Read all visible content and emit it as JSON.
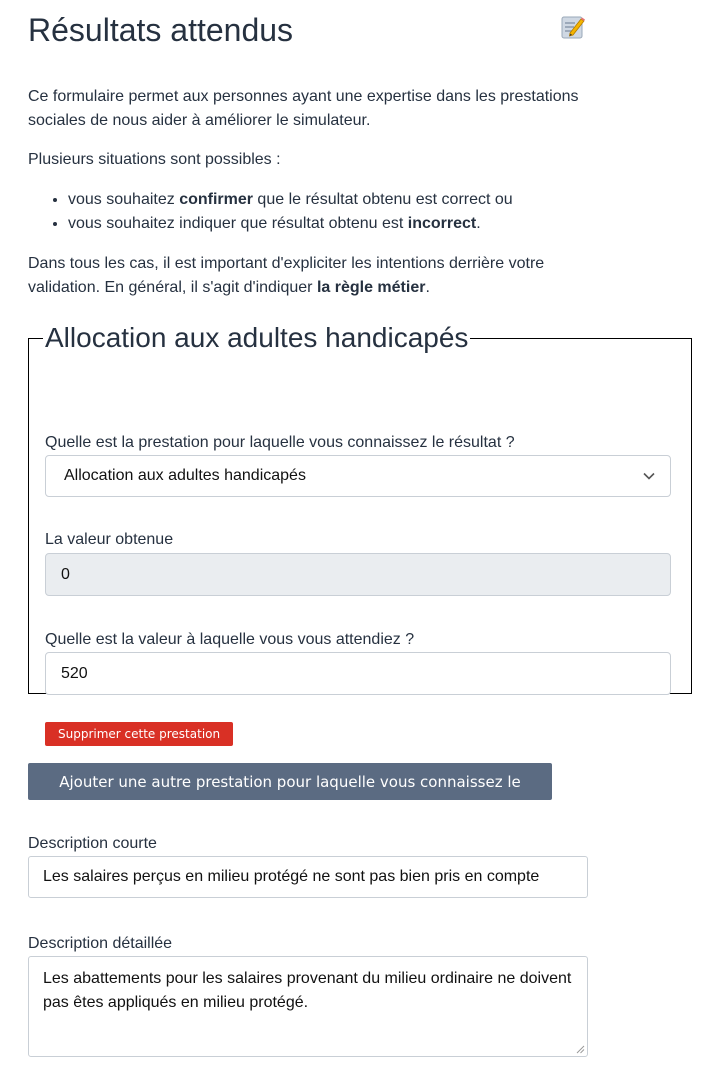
{
  "header": {
    "title": "Résultats attendus",
    "icon": "memo-icon"
  },
  "intro": {
    "paragraph": "Ce formulaire permet aux personnes ayant une expertise dans les prestations sociales de nous aider à améliorer le simulateur.",
    "situations": "Plusieurs situations sont possibles :",
    "case1": {
      "before": "vous souhaitez ",
      "bold": "confirmer",
      "after": " que le résultat obtenu est correct ou"
    },
    "case2": {
      "before": "vous souhaitez indiquer que résultat obtenu est ",
      "bold": "incorrect",
      "after": "."
    },
    "dans": {
      "before": "Dans tous les cas, il est important d'expliciter les intentions derrière votre validation. En général, il s'agit d'indiquer ",
      "bold": "la règle métier",
      "after": "."
    }
  },
  "prestation": {
    "legend": "Allocation aux adultes handicapés",
    "select_label": "Quelle est la prestation pour laquelle vous connaissez le résultat ?",
    "select_value": "Allocation aux adultes handicapés",
    "obtained_label": "La valeur obtenue",
    "obtained_value": "0",
    "expected_label": "Quelle est la valeur à laquelle vous vous attendiez ?",
    "expected_value": "520",
    "delete_label": "Supprimer cette prestation"
  },
  "add_button": "Ajouter une autre prestation pour laquelle vous connaissez le résultat",
  "short_desc": {
    "label": "Description courte",
    "value": "Les salaires perçus en milieu protégé ne sont pas bien pris en compte"
  },
  "long_desc": {
    "label": "Description détaillée",
    "value": "Les abattements pour les salaires provenant du milieu ordinaire ne doivent pas êtes appliqués en milieu protégé."
  },
  "colors": {
    "text": "#263140",
    "danger": "#d93025",
    "secondary": "#5b6b82",
    "readonly_bg": "#eaedf0"
  }
}
